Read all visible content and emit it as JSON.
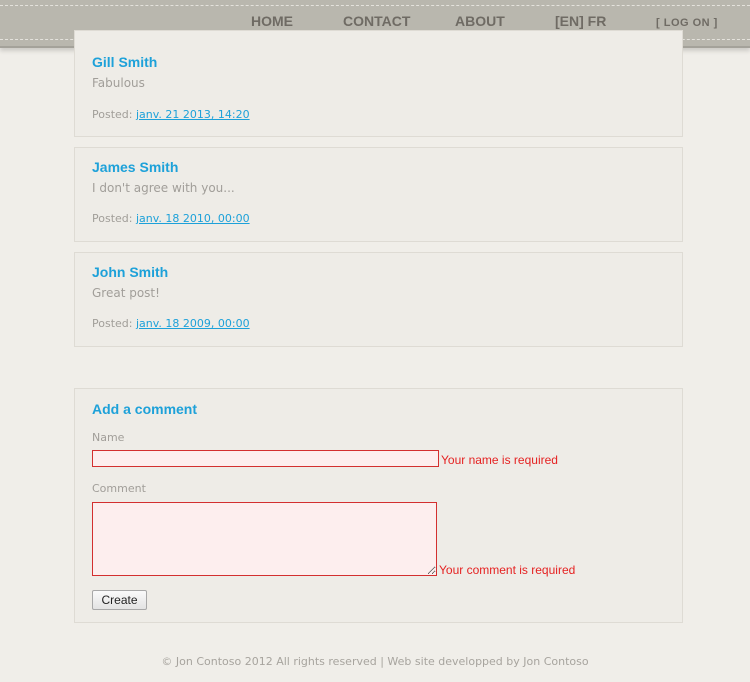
{
  "nav": {
    "home": "HOME",
    "contact": "CONTACT",
    "about": "ABOUT",
    "language": "[EN] FR",
    "login": "[ LOG ON ]"
  },
  "comments": [
    {
      "author": "Gill Smith",
      "text": "Fabulous",
      "posted_label": "Posted:",
      "date": "janv. 21 2013, 14:20"
    },
    {
      "author": "James Smith",
      "text": "I don't agree with you...",
      "posted_label": "Posted:",
      "date": "janv. 18 2010, 00:00"
    },
    {
      "author": "John Smith",
      "text": "Great post!",
      "posted_label": "Posted:",
      "date": "janv. 18 2009, 00:00"
    }
  ],
  "form": {
    "title": "Add a comment",
    "name_label": "Name",
    "name_value": "",
    "name_error": "Your name is required",
    "comment_label": "Comment",
    "comment_value": "",
    "comment_error": "Your comment is required",
    "submit_label": "Create"
  },
  "footer": {
    "text": "© Jon Contoso 2012 All rights reserved | Web site developped by Jon Contoso"
  },
  "colors": {
    "accent": "#1da1d9",
    "error": "#e52222",
    "nav_bg": "#b9b7ae",
    "page_bg": "#f0eee9"
  }
}
